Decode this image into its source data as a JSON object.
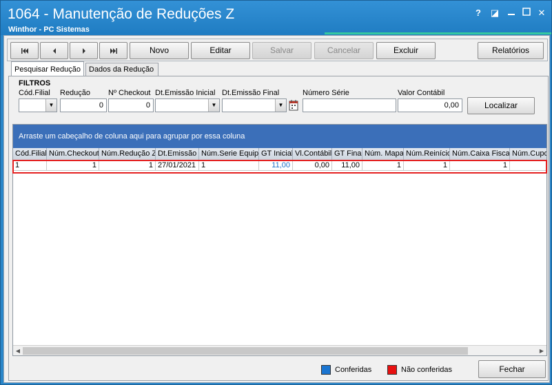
{
  "window": {
    "title": "1064 - Manutenção de Reduções Z",
    "subtitle": "Winthor - PC Sistemas",
    "icons": [
      "help-icon",
      "minimize-to-tray-icon",
      "close-x-icon",
      "maximize-icon",
      "close-icon"
    ],
    "help_glyph": "?",
    "tray_glyph": "◪",
    "x_glyph": "✕",
    "max_glyph": "▫",
    "close_glyph": "✕"
  },
  "toolbar": {
    "first": "⏮",
    "prev": "◀",
    "next": "▶",
    "last": "⏭",
    "novo": "Novo",
    "editar": "Editar",
    "salvar": "Salvar",
    "cancelar": "Cancelar",
    "excluir": "Excluir",
    "relatorios": "Relatórios"
  },
  "tabs": [
    "Pesquisar Redução",
    "Dados da Redução"
  ],
  "filters": {
    "section": "FILTROS",
    "cod_filial_label": "Cód.Filial",
    "reducao_label": "Redução",
    "reducao_value": "0",
    "checkout_label": "Nº Checkout",
    "checkout_value": "0",
    "dt_inicial_label": "Dt.Emissão Inicial",
    "dt_final_label": "Dt.Emissão Final",
    "numero_serie_label": "Número Série",
    "valor_contabil_label": "Valor Contábil",
    "valor_contabil_value": "0,00",
    "localizar": "Localizar"
  },
  "grid": {
    "group_hint": "Arraste um cabeçalho de coluna aqui para agrupar por essa coluna",
    "columns": [
      "Cód.Filial",
      "Núm.Checkout",
      "Núm.Redução Z",
      "Dt.Emissão",
      "Núm.Serie Equip.",
      "GT Inicial",
      "Vl.Contábil",
      "GT Final",
      "Núm. Mapa",
      "Núm.Reinício",
      "Núm.Caixa Fiscal",
      "Núm.Cupom"
    ],
    "rows": [
      [
        "1",
        "1",
        "1",
        "27/01/2021",
        "1",
        "11,00",
        "0,00",
        "11,00",
        "1",
        "1",
        "1",
        ""
      ]
    ]
  },
  "legend": {
    "conferidas": "Conferidas",
    "nao_conferidas": "Não conferidas",
    "conferidas_color": "#1a75d1",
    "nao_conferidas_color": "#e81010"
  },
  "footer": {
    "fechar": "Fechar"
  }
}
